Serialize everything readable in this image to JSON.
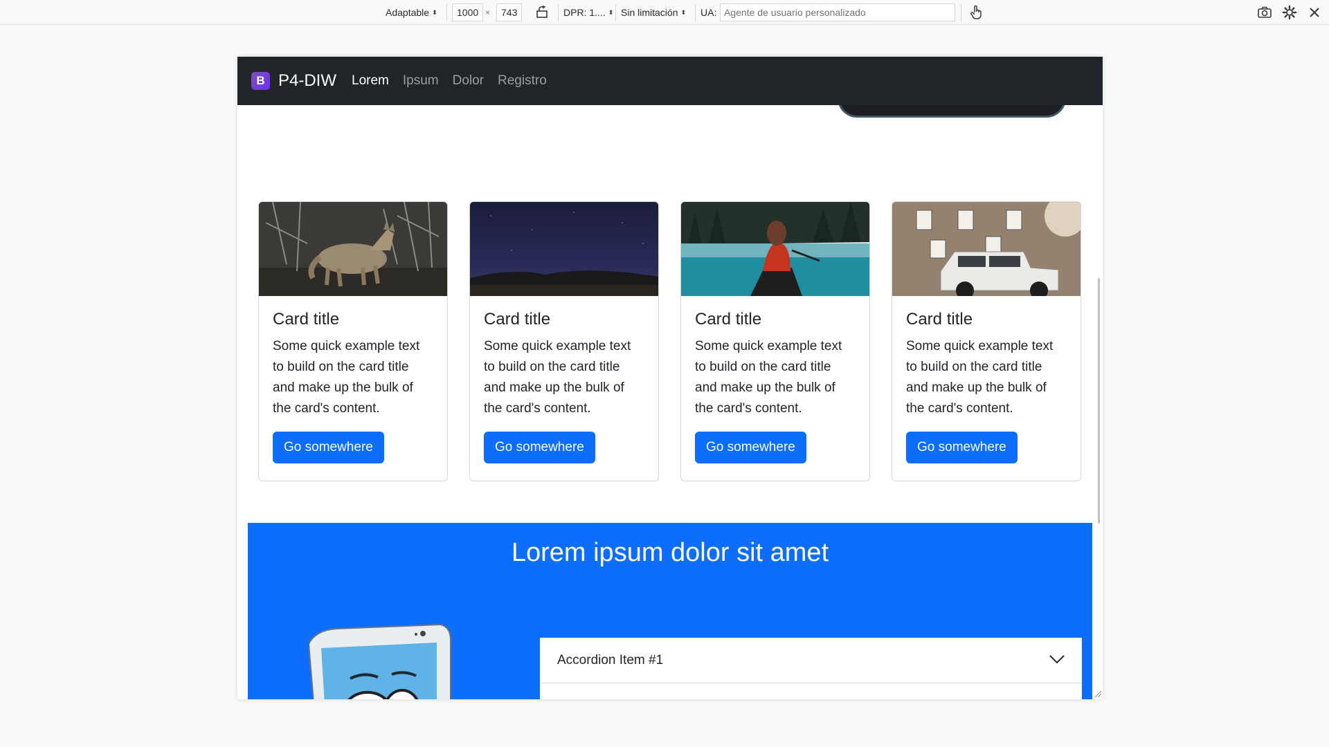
{
  "toolbar": {
    "device_label": "Adaptable",
    "width_value": "1000",
    "times": "×",
    "height_value": "743",
    "dpr_label": "DPR: 1....",
    "throttle_label": "Sin limitación",
    "ua_label": "UA:",
    "ua_placeholder": "Agente de usuario personalizado"
  },
  "navbar": {
    "brand_logo": "B",
    "brand": "P4-DIW",
    "links": [
      "Lorem",
      "Ipsum",
      "Dolor",
      "Registro"
    ]
  },
  "cards": [
    {
      "title": "Card title",
      "text": "Some quick example text to build on the card title and make up the bulk of the card's content.",
      "button": "Go somewhere"
    },
    {
      "title": "Card title",
      "text": "Some quick example text to build on the card title and make up the bulk of the card's content.",
      "button": "Go somewhere"
    },
    {
      "title": "Card title",
      "text": "Some quick example text to build on the card title and make up the bulk of the card's content.",
      "button": "Go somewhere"
    },
    {
      "title": "Card title",
      "text": "Some quick example text to build on the card title and make up the bulk of the card's content.",
      "button": "Go somewhere"
    }
  ],
  "section": {
    "title": "Lorem ipsum dolor sit amet",
    "accordion_item": "Accordion Item #1"
  },
  "colors": {
    "navbar_bg": "#212529",
    "primary": "#0d6efd",
    "brand_purple": "#712cf9"
  }
}
